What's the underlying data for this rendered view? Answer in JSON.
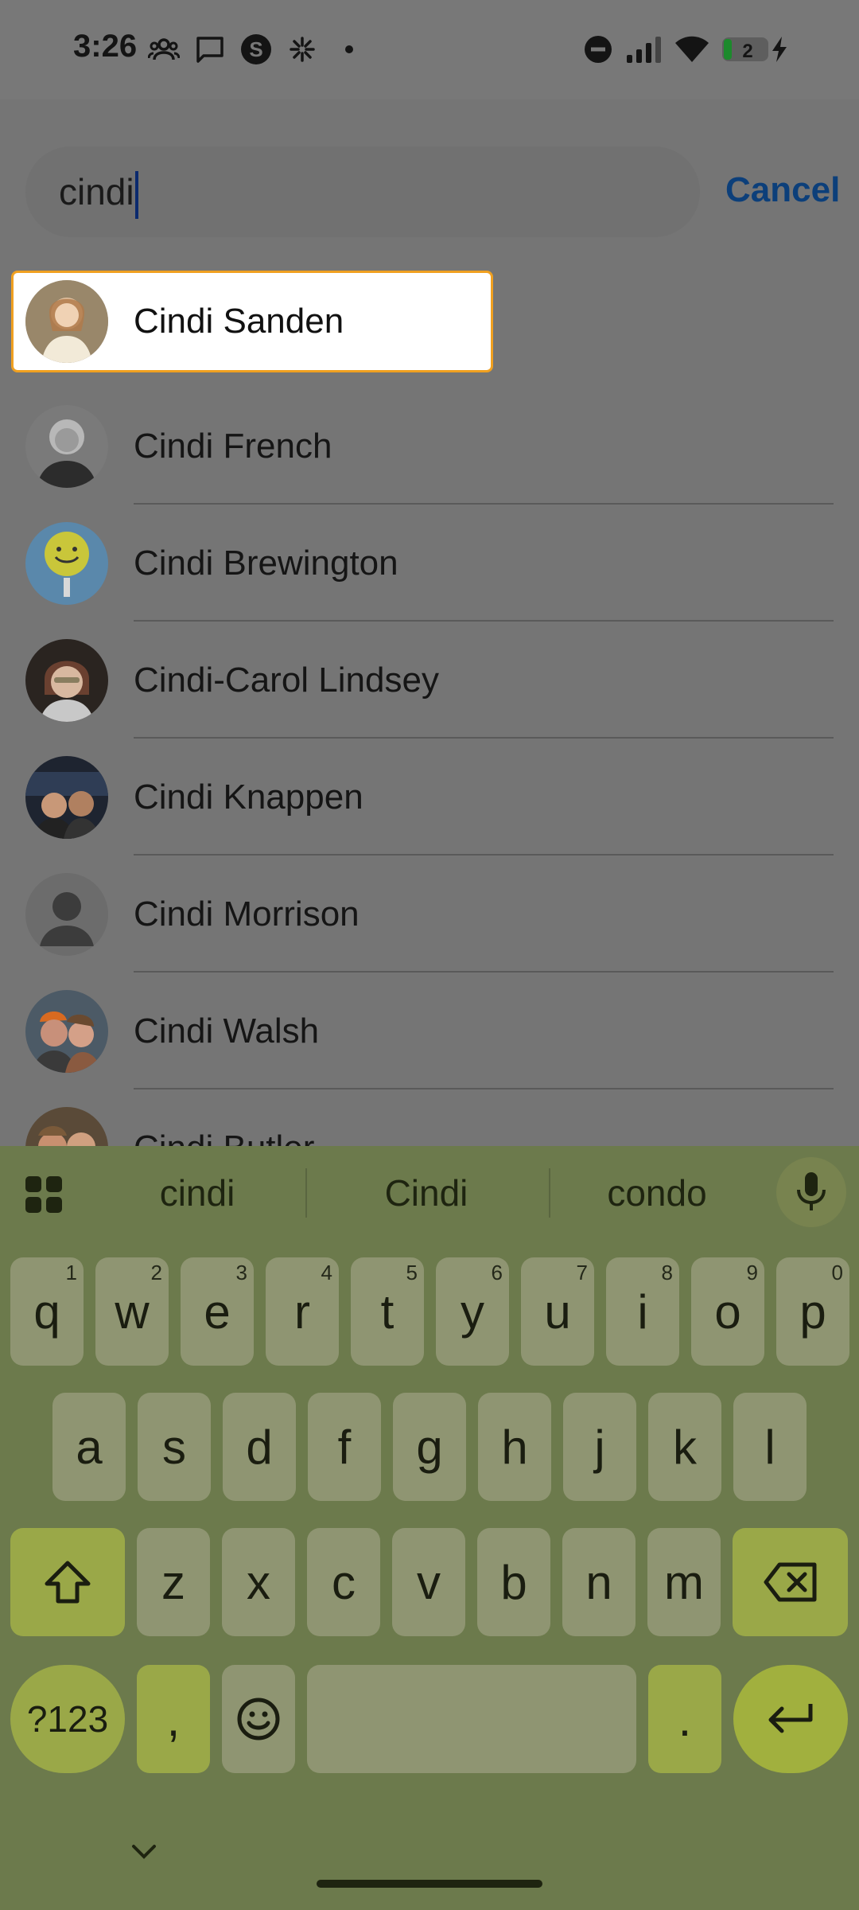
{
  "status_bar": {
    "time": "3:26",
    "battery_level": "2",
    "left_icons": [
      "people-icon",
      "message-icon",
      "s-app-icon",
      "asterisk-icon",
      "dot-icon"
    ],
    "right_icons": [
      "dnd-icon",
      "signal-icon",
      "wifi-icon",
      "battery-icon",
      "charging-icon"
    ]
  },
  "search": {
    "query": "cindi",
    "cancel_label": "Cancel"
  },
  "contacts": [
    {
      "name": "Cindi Sanden",
      "highlighted": true,
      "avatar_color": "#b89a7a"
    },
    {
      "name": "Cindi French",
      "avatar_color": "#6a6a6a"
    },
    {
      "name": "Cindi Brewington",
      "avatar_color": "#4a7aa0"
    },
    {
      "name": "Cindi-Carol Lindsey",
      "avatar_color": "#4a3a30"
    },
    {
      "name": "Cindi Knappen",
      "avatar_color": "#2a2a30"
    },
    {
      "name": "Cindi Morrison",
      "avatar_color": "#6a6a6a",
      "placeholder": true
    },
    {
      "name": "Cindi Walsh",
      "avatar_color": "#5a4a40"
    },
    {
      "name": "Cindi Butler",
      "avatar_color": "#6a5a3a"
    }
  ],
  "keyboard": {
    "suggestions": [
      "cindi",
      "Cindi",
      "condo"
    ],
    "row1": [
      {
        "k": "q",
        "h": "1"
      },
      {
        "k": "w",
        "h": "2"
      },
      {
        "k": "e",
        "h": "3"
      },
      {
        "k": "r",
        "h": "4"
      },
      {
        "k": "t",
        "h": "5"
      },
      {
        "k": "y",
        "h": "6"
      },
      {
        "k": "u",
        "h": "7"
      },
      {
        "k": "i",
        "h": "8"
      },
      {
        "k": "o",
        "h": "9"
      },
      {
        "k": "p",
        "h": "0"
      }
    ],
    "row2": [
      "a",
      "s",
      "d",
      "f",
      "g",
      "h",
      "j",
      "k",
      "l"
    ],
    "row3": [
      "z",
      "x",
      "c",
      "v",
      "b",
      "n",
      "m"
    ],
    "symbols_label": "?123",
    "comma_label": ",",
    "period_label": ".",
    "accent_color": "#9aa848"
  }
}
